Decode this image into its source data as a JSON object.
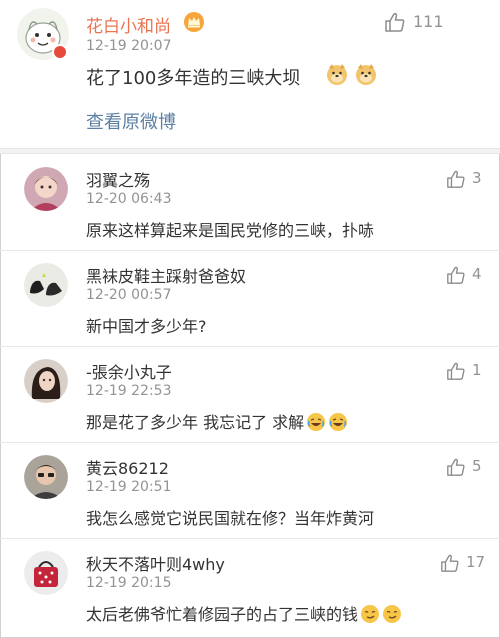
{
  "post": {
    "author": "花白小和尚",
    "time": "12-19 20:07",
    "content": "花了100多年造的三峡大坝",
    "view_original": "查看原微博",
    "like_count": "111",
    "icons": {
      "avatar": "cartoon-avatar-icon",
      "vip": "vip-crown-icon",
      "emoji": "doge-emoji-icon",
      "like": "thumbs-up-icon"
    }
  },
  "comments": [
    {
      "author": "羽翼之殇",
      "time": "12-20 06:43",
      "text": "原来这样算起来是国民党修的三峡，扑哧",
      "like_count": "3"
    },
    {
      "author": "黑袜皮鞋主踩射爸爸奴",
      "time": "12-20 00:57",
      "text": "新中国才多少年?",
      "like_count": "4"
    },
    {
      "author": "-張余小丸子",
      "time": "12-19 22:53",
      "text": "那是花了多少年 我忘记了 求解",
      "like_count": "1"
    },
    {
      "author": "黄云86212",
      "time": "12-19 20:51",
      "text": "我怎么感觉它说民国就在修？当年炸黄河",
      "like_count": "5"
    },
    {
      "author": "秋天不落叶则4why",
      "time": "12-19 20:15",
      "text": "太后老佛爷忙着修园子的占了三峡的钱",
      "like_count": "17"
    }
  ],
  "colors": {
    "author_orange": "#eb7350",
    "link_blue": "#5d7fa4",
    "meta_gray": "#939393",
    "text_dark": "#333333"
  }
}
